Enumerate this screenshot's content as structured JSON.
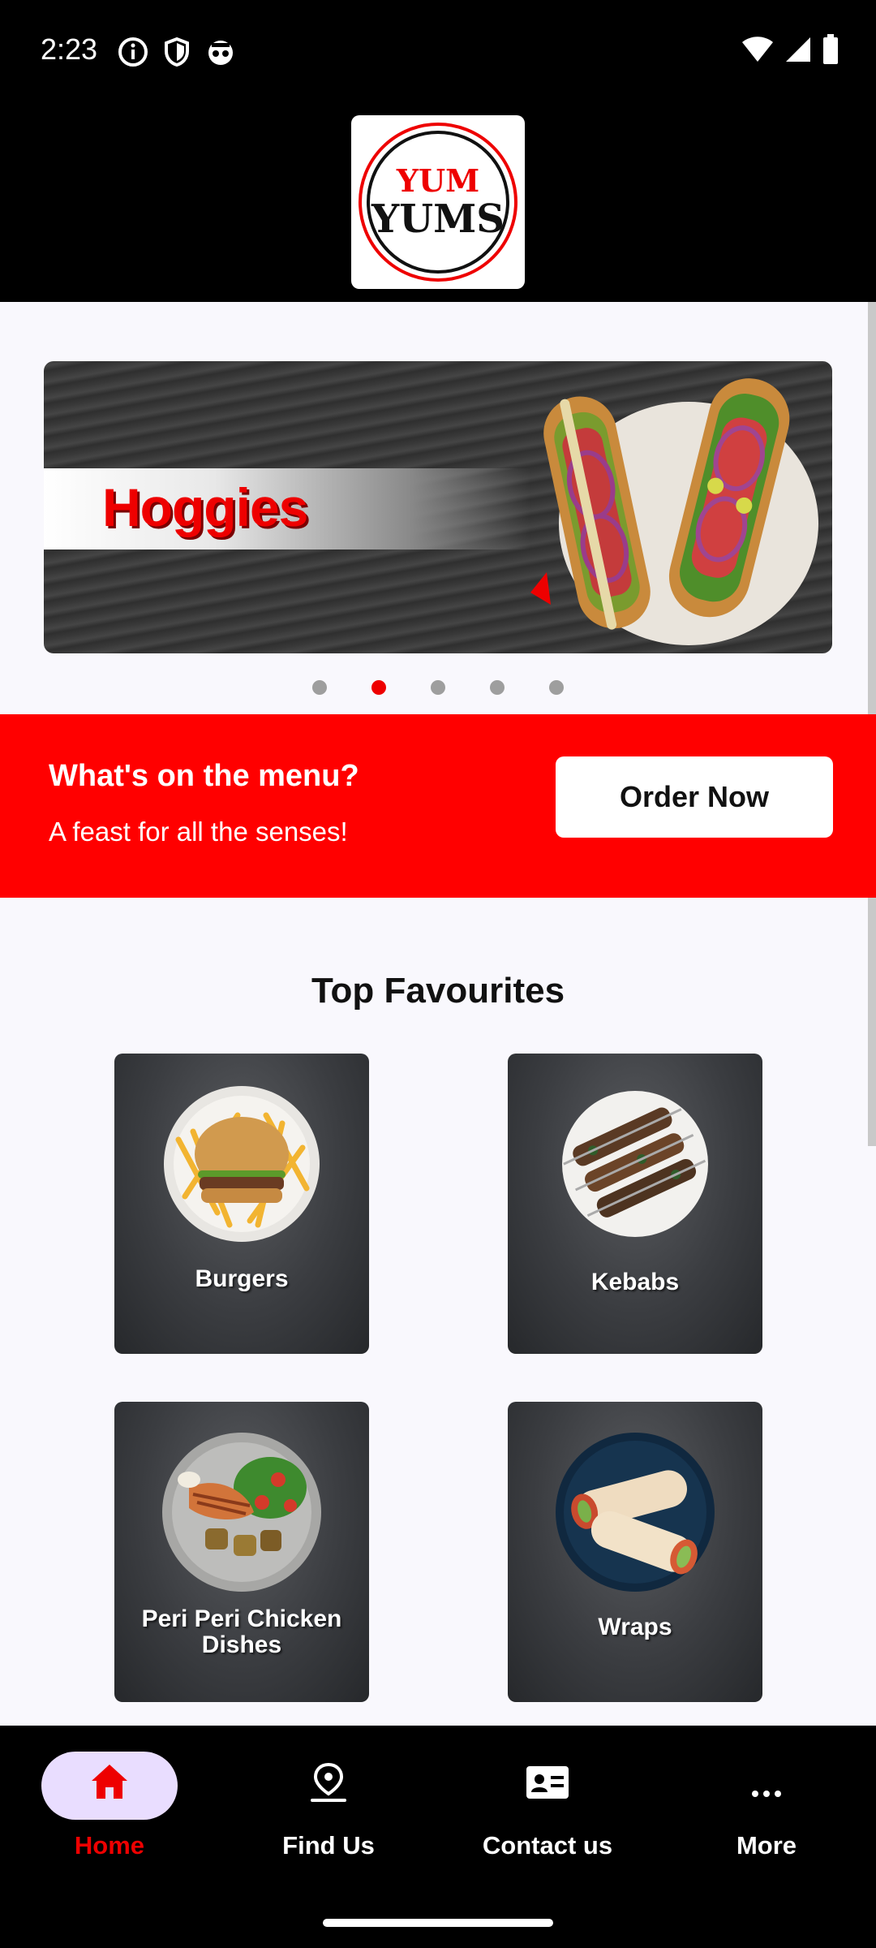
{
  "status_bar": {
    "time": "2:23"
  },
  "header": {
    "logo_line1": "YUM",
    "logo_line2": "YUMS"
  },
  "banner": {
    "title": "Hoggies",
    "dots_total": 5,
    "active_dot": 2
  },
  "promo": {
    "title": "What's on the menu?",
    "subtitle": "A feast for all the senses!",
    "button": "Order Now"
  },
  "favourites": {
    "title": "Top Favourites",
    "items": [
      {
        "label": "Burgers"
      },
      {
        "label": "Kebabs"
      },
      {
        "label": "Peri Peri Chicken Dishes"
      },
      {
        "label": "Wraps"
      }
    ]
  },
  "bottom_nav": {
    "items": [
      {
        "label": "Home",
        "icon": "home-icon",
        "active": true
      },
      {
        "label": "Find Us",
        "icon": "location-pin-icon"
      },
      {
        "label": "Contact us",
        "icon": "contact-card-icon"
      },
      {
        "label": "More",
        "icon": "more-dots-icon"
      }
    ]
  },
  "colors": {
    "brand_red": "#ff0000",
    "nav_pill": "#e9ddff"
  }
}
